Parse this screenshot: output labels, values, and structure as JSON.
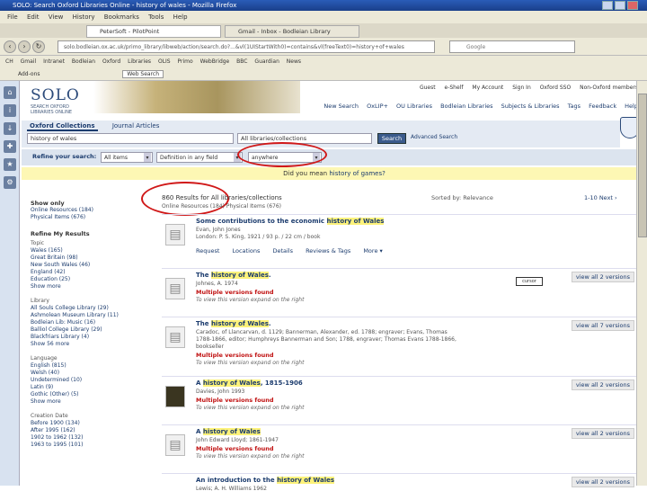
{
  "window": {
    "title": "SOLO: Search Oxford Libraries Online - history of wales - Mozilla Firefox"
  },
  "menu": [
    "File",
    "Edit",
    "View",
    "History",
    "Bookmarks",
    "Tools",
    "Help"
  ],
  "tabs": [
    "PeterSoft - PilotPoint",
    "Gmail - Inbox - Bodleian Library"
  ],
  "navbar": {
    "url": "solo.bodleian.ox.ac.uk/primo_library/libweb/action/search.do?...&vl(1UIStartWith0)=contains&vl(freeText0)=history+of+wales",
    "search_placeholder": "Google"
  },
  "bookmarks": [
    "CH",
    "Gmail",
    "Intranet",
    "Bodleian",
    "Oxford",
    "Libraries",
    "OLIS",
    "Primo",
    "WebBridge",
    "BBC",
    "Guardian",
    "News"
  ],
  "addonbar": {
    "label": "Add-ons",
    "search_label": "Web Search"
  },
  "header": {
    "logo": "SOLO",
    "logo_sub": "SEARCH OXFORD LIBRARIES ONLINE",
    "userlinks": [
      "Guest",
      "e-Shelf",
      "My Account",
      "Sign In",
      "Oxford SSO",
      "Non-Oxford members"
    ],
    "topnav": [
      "New Search",
      "OxLIP+",
      "OU Libraries",
      "Bodleian Libraries",
      "Subjects & Libraries",
      "Tags",
      "Feedback",
      "Help"
    ]
  },
  "search": {
    "tab_active": "Oxford Collections",
    "tab_inactive": "Journal Articles",
    "query": "history of wales",
    "scope": "All libraries/collections",
    "button": "Search",
    "advanced": "Advanced Search"
  },
  "refine": {
    "label": "Refine your search:",
    "selects": [
      "All items",
      "Definition in any field",
      "anywhere"
    ]
  },
  "didyoumean": {
    "prefix": "Did you mean",
    "suggestion": "history of games?"
  },
  "results": {
    "count": "860 Results for All libraries/collections",
    "sorted": "Sorted by: Relevance",
    "range": "1-10 Next ›",
    "showonly": "Online Resources (184)   Physical Items (676)"
  },
  "facets": {
    "show_only": {
      "heading": "Show only",
      "items": [
        "Online Resources (184)",
        "Physical Items (676)"
      ]
    },
    "refine_heading": "Refine My Results",
    "topic": {
      "heading": "Topic",
      "items": [
        "Wales (165)",
        "Great Britain (98)",
        "New South Wales (46)",
        "England (42)",
        "Education (25)",
        "Show more"
      ]
    },
    "library": {
      "heading": "Library",
      "items": [
        "All Souls College Library (29)",
        "Ashmolean Museum Library (11)",
        "Bodleian Lib: Music (16)",
        "Balliol College Library (29)",
        "Blackfriars Library (4)",
        "Show 56 more"
      ]
    },
    "language": {
      "heading": "Language",
      "items": [
        "English (815)",
        "Welsh (40)",
        "Undetermined (10)",
        "Latin (9)",
        "Gothic (Other) (5)",
        "Show more"
      ]
    },
    "creation_date": {
      "heading": "Creation Date",
      "items": [
        "Before 1900 (134)",
        "After 1995 (162)",
        "1902 to 1962 (132)",
        "1963 to 1995 (101)"
      ]
    }
  },
  "records": [
    {
      "type": "Book",
      "title_pre": "Some contributions to the economic ",
      "title_hl": "history of Wales",
      "title_post": "",
      "meta": "Evan, John Jones\nLondon: P. S. King, 1921 / 93 p. / 22 cm / book",
      "actions": [
        "Request",
        "Locations",
        "Details",
        "Reviews & Tags",
        "More ▾"
      ],
      "mv": "",
      "note": "",
      "va": ""
    },
    {
      "type": "Book",
      "title_pre": "The ",
      "title_hl": "history of Wales",
      "title_post": ".",
      "meta": "Johnes, A. 1974",
      "actions": [],
      "mv": "Multiple versions found",
      "note": "To view this version expand on the right",
      "va": "view all 2 versions"
    },
    {
      "type": "Book",
      "title_pre": "The ",
      "title_hl": "history of Wales",
      "title_post": ".",
      "meta": "Caradoc, of Llancarvan, d. 1129; Bannerman, Alexander, ed. 1788; engraver; Evans, Thomas\n1788-1866, editor; Humphreys Bannerman and Son; 1788, engraver; Thomas Evans 1788-1866,\nbookseller",
      "actions": [],
      "mv": "Multiple versions found",
      "note": "To view this version expand on the right",
      "va": "view all 7 versions"
    },
    {
      "type": "cover",
      "title_pre": "A ",
      "title_hl": "history of Wales",
      "title_post": ", 1815-1906",
      "meta": "Davies, John 1993",
      "actions": [],
      "mv": "Multiple versions found",
      "note": "To view this version expand on the right",
      "va": "view all 2 versions"
    },
    {
      "type": "Book",
      "title_pre": "A ",
      "title_hl": "history of Wales",
      "title_post": "",
      "meta": "John Edward Lloyd; 1861-1947",
      "actions": [],
      "mv": "Multiple versions found",
      "note": "To view this version expand on the right",
      "va": "view all 2 versions"
    },
    {
      "type": "Book",
      "title_pre": "An introduction to the ",
      "title_hl": "history of Wales",
      "title_post": "",
      "meta": "Lewis; A. H. Williams 1962",
      "actions": [],
      "mv": "",
      "note": "",
      "va": "view all 2 versions"
    }
  ],
  "tooltip": "cursor"
}
